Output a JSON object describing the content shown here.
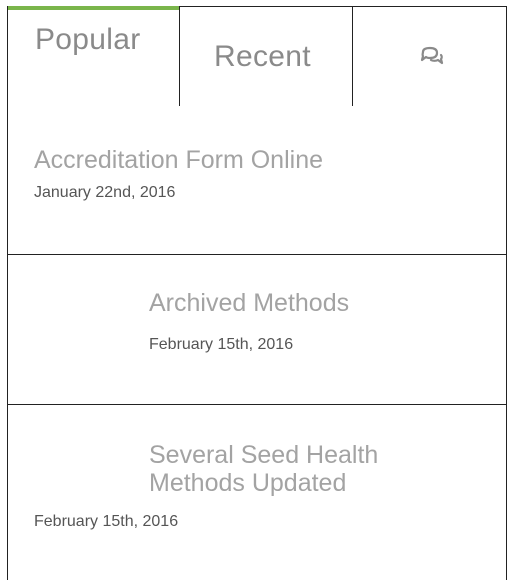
{
  "tabs": {
    "popular": "Popular",
    "recent": "Recent",
    "comments_icon": "comments-icon"
  },
  "posts": [
    {
      "title": "Accreditation Form Online",
      "date": "January 22nd, 2016"
    },
    {
      "title": "Archived Methods",
      "date": "February 15th, 2016"
    },
    {
      "title": "Several Seed Health Methods Updated",
      "date": "February 15th, 2016"
    }
  ],
  "colors": {
    "active_tab_accent": "#7ab54b",
    "title_text": "#a3a3a3",
    "border": "#222222"
  }
}
